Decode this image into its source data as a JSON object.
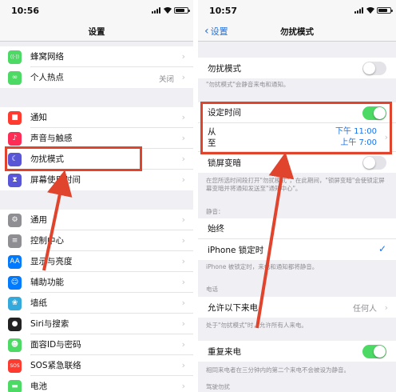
{
  "left": {
    "status": {
      "time": "10:56"
    },
    "nav": {
      "title": "设置"
    },
    "group1": [
      {
        "label": "蜂窝网络",
        "icon": "antenna-icon",
        "color": "#4cd964",
        "glyph": "((·))"
      },
      {
        "label": "个人热点",
        "icon": "hotspot-icon",
        "color": "#4cd964",
        "glyph": "∞",
        "value": "关闭"
      }
    ],
    "group2": [
      {
        "label": "通知",
        "icon": "notification-icon",
        "color": "#ff3b30",
        "glyph": "■"
      },
      {
        "label": "声音与触感",
        "icon": "sound-icon",
        "color": "#ff2d55",
        "glyph": "♪"
      },
      {
        "label": "勿扰模式",
        "icon": "moon-icon",
        "color": "#5856d6",
        "glyph": "☾"
      },
      {
        "label": "屏幕使用时间",
        "icon": "hourglass-icon",
        "color": "#5856d6",
        "glyph": "⧗"
      }
    ],
    "group3": [
      {
        "label": "通用",
        "icon": "gear-icon",
        "color": "#8e8e93",
        "glyph": "⚙"
      },
      {
        "label": "控制中心",
        "icon": "control-center-icon",
        "color": "#8e8e93",
        "glyph": "≡"
      },
      {
        "label": "显示与亮度",
        "icon": "display-icon",
        "color": "#007aff",
        "glyph": "AA"
      },
      {
        "label": "辅助功能",
        "icon": "accessibility-icon",
        "color": "#007aff",
        "glyph": "☺"
      },
      {
        "label": "墙纸",
        "icon": "wallpaper-icon",
        "color": "#34aadc",
        "glyph": "❀"
      },
      {
        "label": "Siri与搜索",
        "icon": "siri-icon",
        "color": "#222222",
        "glyph": "●"
      },
      {
        "label": "面容ID与密码",
        "icon": "faceid-icon",
        "color": "#4cd964",
        "glyph": "☻"
      },
      {
        "label": "SOS紧急联络",
        "icon": "sos-icon",
        "color": "#ff3b30",
        "glyph": "SOS"
      },
      {
        "label": "电池",
        "icon": "battery-icon",
        "color": "#4cd964",
        "glyph": "▬"
      }
    ]
  },
  "right": {
    "status": {
      "time": "10:57"
    },
    "nav": {
      "back": "设置",
      "title": "勿扰模式"
    },
    "dnd": {
      "label": "勿扰模式",
      "on": false,
      "note": "\"勿扰模式\"会静音来电和通知。"
    },
    "scheduled": {
      "label": "设定时间",
      "on": true,
      "from_label": "从",
      "to_label": "至",
      "from": "下午 11:00",
      "to": "上午 7:00"
    },
    "bedtime": {
      "label": "锁屏变暗",
      "on": false,
      "note": "在您所选时间段打开\"勿扰模式\"，在此期间，\"锁屏变暗\"会使锁定屏幕变暗并将通知发送至\"通知中心\"。"
    },
    "silence": {
      "header": "静音：",
      "always": "始终",
      "locked": "iPhone 锁定时",
      "note": "iPhone 被锁定时，来电和通知都将静音。"
    },
    "phone": {
      "header": "电话",
      "allow_label": "允许以下来电",
      "allow_value": "任何人",
      "allow_note": "处于\"勿扰模式\"时，允许所有人来电。",
      "repeat_label": "重复来电",
      "repeat_on": true,
      "repeat_note": "相同来电者在三分钟内的第二个来电不会被设为静音。"
    },
    "driving": {
      "header": "驾驶勿扰"
    }
  },
  "colors": {
    "annotation": "#e0442c",
    "accent": "#1a73e8",
    "toggle_on": "#4cd964"
  }
}
